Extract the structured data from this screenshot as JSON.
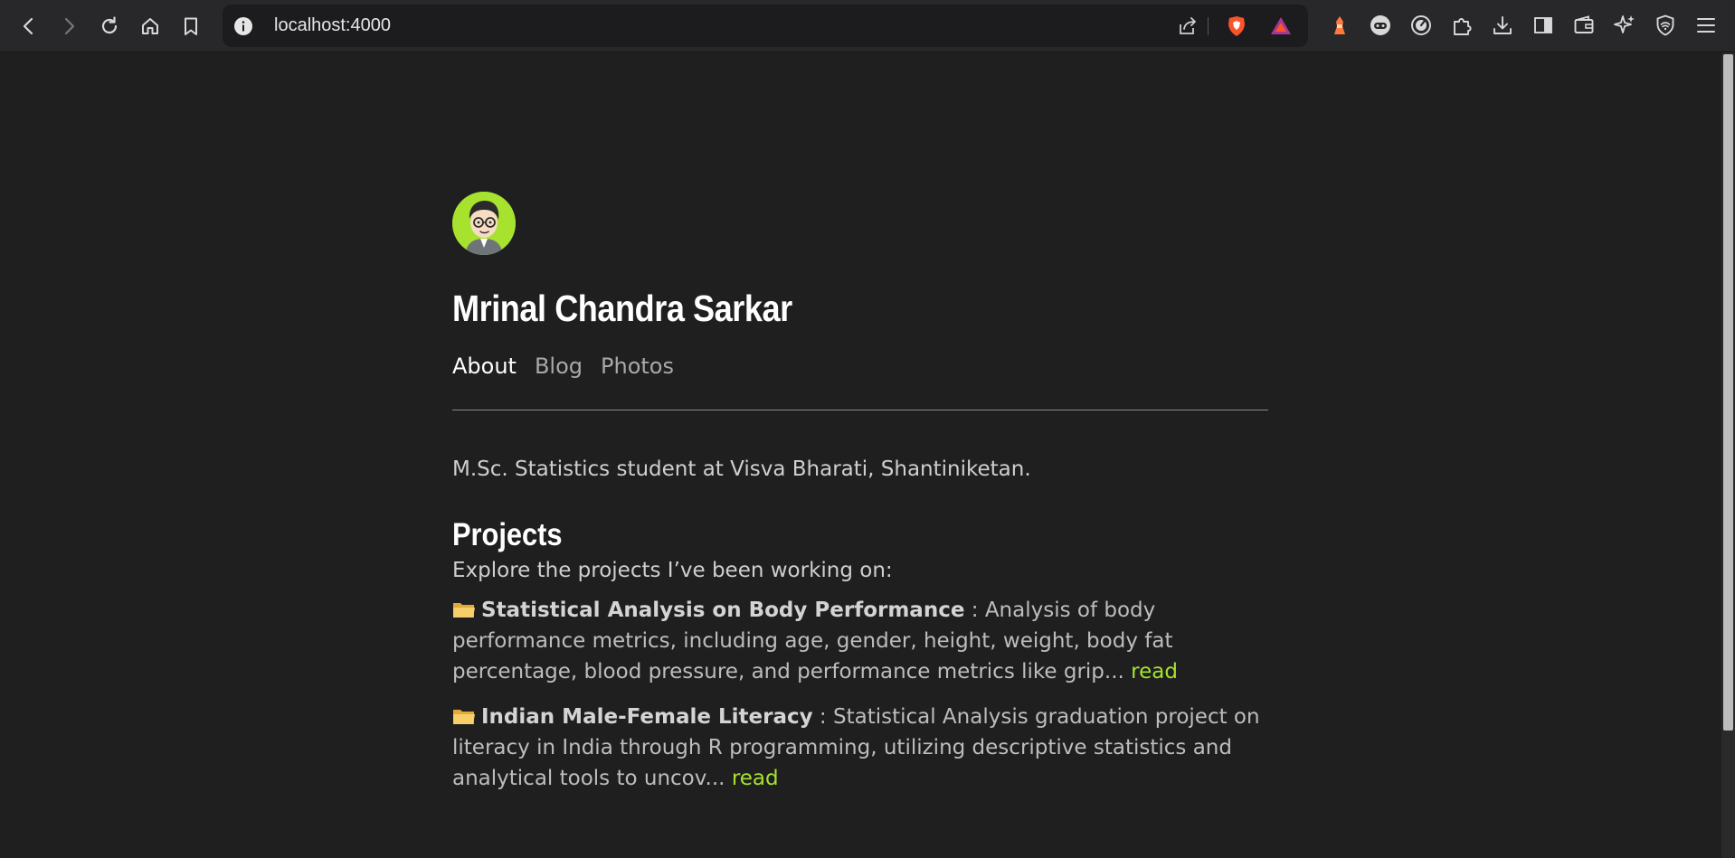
{
  "browser": {
    "url": "localhost:4000",
    "nav_icons": [
      "back-icon",
      "forward-icon",
      "reload-icon",
      "home-icon",
      "bookmark-icon"
    ],
    "url_icons": [
      "info-icon",
      "share-icon",
      "brave-shields-icon",
      "brave-rewards-icon"
    ],
    "extensions": [
      "brave-talk-icon",
      "brave-vpn-bot-icon",
      "speed-icon",
      "extensions-puzzle-icon",
      "download-icon",
      "sidebar-icon",
      "wallet-icon",
      "leo-ai-icon",
      "vpn-shield-icon",
      "menu-icon"
    ]
  },
  "site": {
    "title": "Mrinal Chandra Sarkar",
    "nav": [
      {
        "label": "About",
        "active": true
      },
      {
        "label": "Blog",
        "active": false
      },
      {
        "label": "Photos",
        "active": false
      }
    ],
    "bio": "M.Sc. Statistics student at Visva Bharati, Shantiniketan."
  },
  "projects": {
    "heading": "Projects",
    "intro": "Explore the projects I’ve been working on:",
    "items": [
      {
        "title": "Statistical Analysis on Body Performance",
        "separator": " : ",
        "description": "Analysis of body performance metrics, including age, gender, height, weight, body fat percentage, blood pressure, and performance metrics like grip... ",
        "link": "read"
      },
      {
        "title": "Indian Male-Female Literacy",
        "separator": " : ",
        "description": "Statistical Analysis graduation project on literacy in India through R programming, utilizing descriptive statistics and analytical tools to uncov... ",
        "link": "read"
      }
    ]
  },
  "colors": {
    "background": "#1f1f1f",
    "accent": "#a6e22e",
    "toolbar": "#28282b"
  }
}
